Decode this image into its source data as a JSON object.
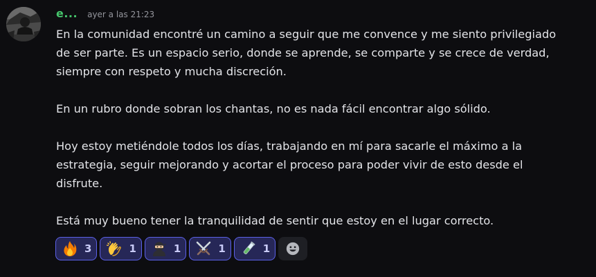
{
  "message": {
    "author": "e...",
    "timestamp": "ayer a las 21:23",
    "paragraphs": [
      [
        "En la comunidad encontré un camino a seguir que me convence y me siento privilegiado",
        "de ser parte. Es un espacio serio, donde se aprende, se comparte y se crece de verdad,",
        "siempre con respeto y mucha discreción."
      ],
      [
        "En un rubro donde sobran los chantas, no es nada fácil encontrar algo sólido."
      ],
      [
        "Hoy estoy metiéndole todos los días, trabajando en mí para sacarle el máximo a la",
        "estrategia, seguir mejorando y acortar el proceso para poder vivir de esto desde el",
        "disfrute."
      ],
      [
        "Está muy bueno tener la tranquilidad de sentir que estoy en el lugar correcto."
      ]
    ]
  },
  "reactions": [
    {
      "emoji": "fire-icon",
      "count": "3"
    },
    {
      "emoji": "clapping-hands-icon",
      "count": "1"
    },
    {
      "emoji": "ninja-icon",
      "count": "1"
    },
    {
      "emoji": "crossed-swords-icon",
      "count": "1"
    },
    {
      "emoji": "test-tube-icon",
      "count": "1"
    }
  ],
  "add_reaction_icon": "add-reaction-smiley-icon",
  "colors": {
    "background": "#0d0d10",
    "username": "#45c46b",
    "text": "#e3e4e8",
    "timestamp": "#94959c",
    "reaction_bg": "#262757",
    "reaction_border": "#5c61e8"
  }
}
